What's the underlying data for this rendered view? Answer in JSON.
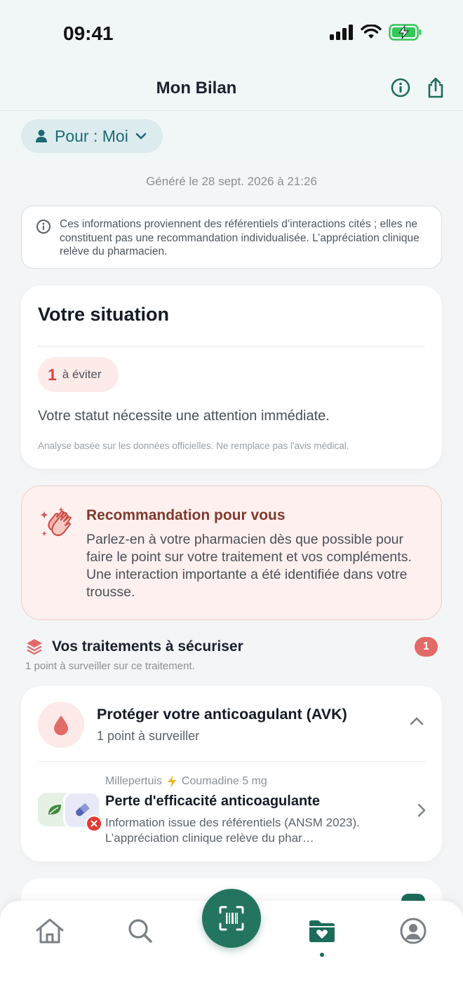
{
  "status_bar": {
    "time": "09:41"
  },
  "header": {
    "title": "Mon Bilan"
  },
  "profile_selector": {
    "label": "Pour : Moi"
  },
  "generated": "Généré le 28 sept. 2026 à 21:26",
  "notice": {
    "text": "Ces informations proviennent des référentiels d’interactions cités ; elles ne constituent pas une recommandation individualisée. L’appréciation clinique relève du pharmacien."
  },
  "situation": {
    "title": "Votre situation",
    "avoid_count": "1",
    "avoid_label": "à éviter",
    "status_text": "Votre statut nécessite une attention immédiate.",
    "footnote": "Analyse basée sur les données officielles. Ne remplace pas l'avis médical."
  },
  "recommendation": {
    "title": "Recommandation pour vous",
    "text": "Parlez-en à votre pharmacien dès que possible pour faire le point sur votre traitement et vos compléments. Une interaction importante a été identifiée dans votre trousse."
  },
  "treatments_section": {
    "title": "Vos traitements à sécuriser",
    "subtitle": "1 point à surveiller sur ce traitement.",
    "count": "1"
  },
  "treatment_card": {
    "title": "Protéger votre anticoagulant (AVK)",
    "subtitle": "1 point à surveiller",
    "interaction": {
      "product_a": "Millepertuis",
      "product_b": "Coumadine 5 mg",
      "title": "Perte d'efficacité anticoagulante",
      "description": "Information issue des référentiels (ANSM 2023). L’appréciation clinique relève du phar…"
    }
  },
  "colors": {
    "primary": "#23755f",
    "danger": "#e33a33",
    "recommendation_bg": "#fdf0ef"
  },
  "tabs": [
    {
      "icon": "home-icon"
    },
    {
      "icon": "search-icon"
    },
    {
      "icon": "barcode-scan-icon"
    },
    {
      "icon": "health-folder-icon",
      "active": true
    },
    {
      "icon": "profile-icon"
    }
  ]
}
